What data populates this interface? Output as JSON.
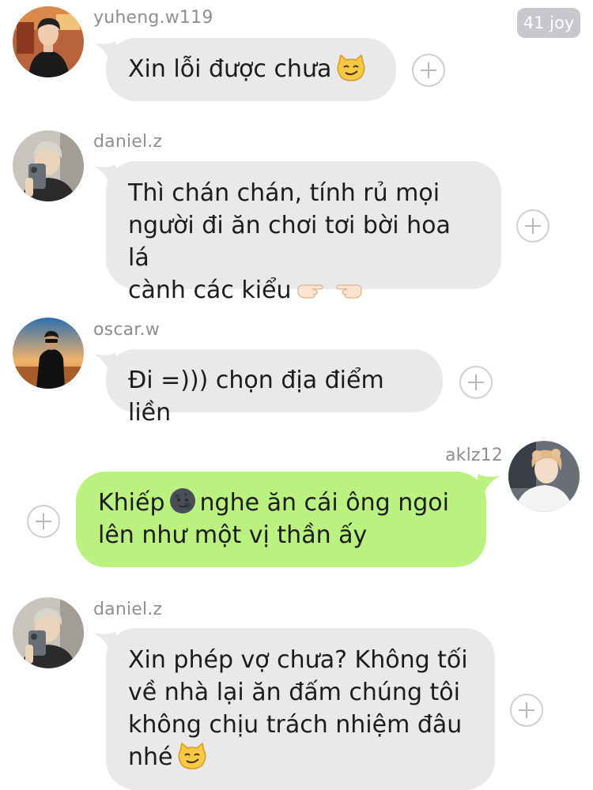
{
  "header": {
    "reaction_badge": "41 joy"
  },
  "messages": [
    {
      "user": "yuheng.w119",
      "text": "Xin lỗi được chưa",
      "emoji": "smirking-cat"
    },
    {
      "user": "daniel.z",
      "lines": [
        "Thì chán chán, tính rủ mọi",
        "người đi ăn chơi tơi bời hoa lá",
        "cành các kiểu"
      ],
      "emoji": "pointing-hands"
    },
    {
      "user": "oscar.w",
      "text": "Đi =))) chọn địa điểm liền"
    },
    {
      "user": "aklz12",
      "line1_before": "Khiếp",
      "line1_after": "nghe ăn cái ông ngoi",
      "line2": "lên như một vị thần ấy",
      "emoji": "new-moon-face"
    },
    {
      "user": "daniel.z",
      "lines": [
        "Xin phép vợ chưa? Không tối",
        "về nhà lại ăn đấm chúng tôi",
        "không chịu trách nhiệm đâu",
        "nhé"
      ],
      "emoji": "smirking-cat"
    }
  ],
  "colors": {
    "incoming_bubble": "#e9e9eb",
    "outgoing_bubble": "#b9f27e",
    "username": "#8e8e93"
  }
}
